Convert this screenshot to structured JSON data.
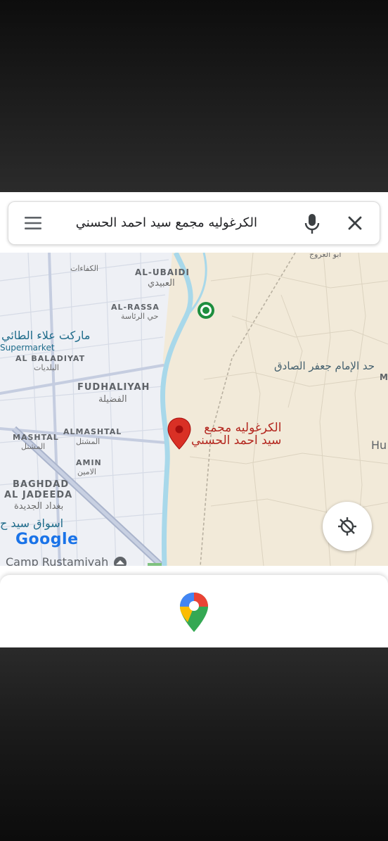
{
  "search": {
    "query": "الكرغوليه مجمع سيد احمد الحسني"
  },
  "icons": {
    "menu": "menu-icon",
    "mic": "mic-icon",
    "close": "close-icon",
    "locate": "my-location-off-icon",
    "pin": "red-location-pin",
    "poi": "green-place-marker",
    "app": "google-maps-icon",
    "camp": "military-marker-icon"
  },
  "map": {
    "labels": {
      "abu_arooj": "ابو العروج",
      "kafaat": "الكفاءات",
      "al_ubaidi_en": "AL-UBAIDI",
      "al_ubaidi_ar": "العبيدي",
      "al_rassa_en": "AL-RASSA",
      "al_rassa_ar": "حي الرئاسة",
      "supermarket_ar": "ماركت علاء الطائي",
      "supermarket_en": "Supermarket",
      "baladiyat_en": "AL BALADIYAT",
      "baladiyat_ar": "البلديات",
      "imam_jaafar": "حد الإمام جعفر الصادق",
      "imam_letter": "M",
      "fudhaliyah_en": "FUDHALIYAH",
      "fudhaliyah_ar": "الفضيلة",
      "mashtal_en": "MASHTAL",
      "mashtal_ar": "المشتل",
      "almashtal_en": "ALMASHTAL",
      "almashtal_ar": "المشتل",
      "amin_en": "AMIN",
      "amin_ar": "الامين",
      "baghdad_en_1": "BAGHDAD",
      "baghdad_en_2": "AL JADEEDA",
      "baghdad_ar": "بغداد الجديدة",
      "aswaq": "اسواق سيد ح",
      "hu": "Hu",
      "camp": "Camp Rustamiyah"
    },
    "pin_label_line1": "الكرغوليه مجمع",
    "pin_label_line2": "سيد احمد الحسني",
    "attribution": "Google"
  },
  "colors": {
    "pin": "#d93025",
    "poi": "#1e8e3e",
    "water": "#a8d8ea",
    "road_major": "#aab4cc"
  }
}
